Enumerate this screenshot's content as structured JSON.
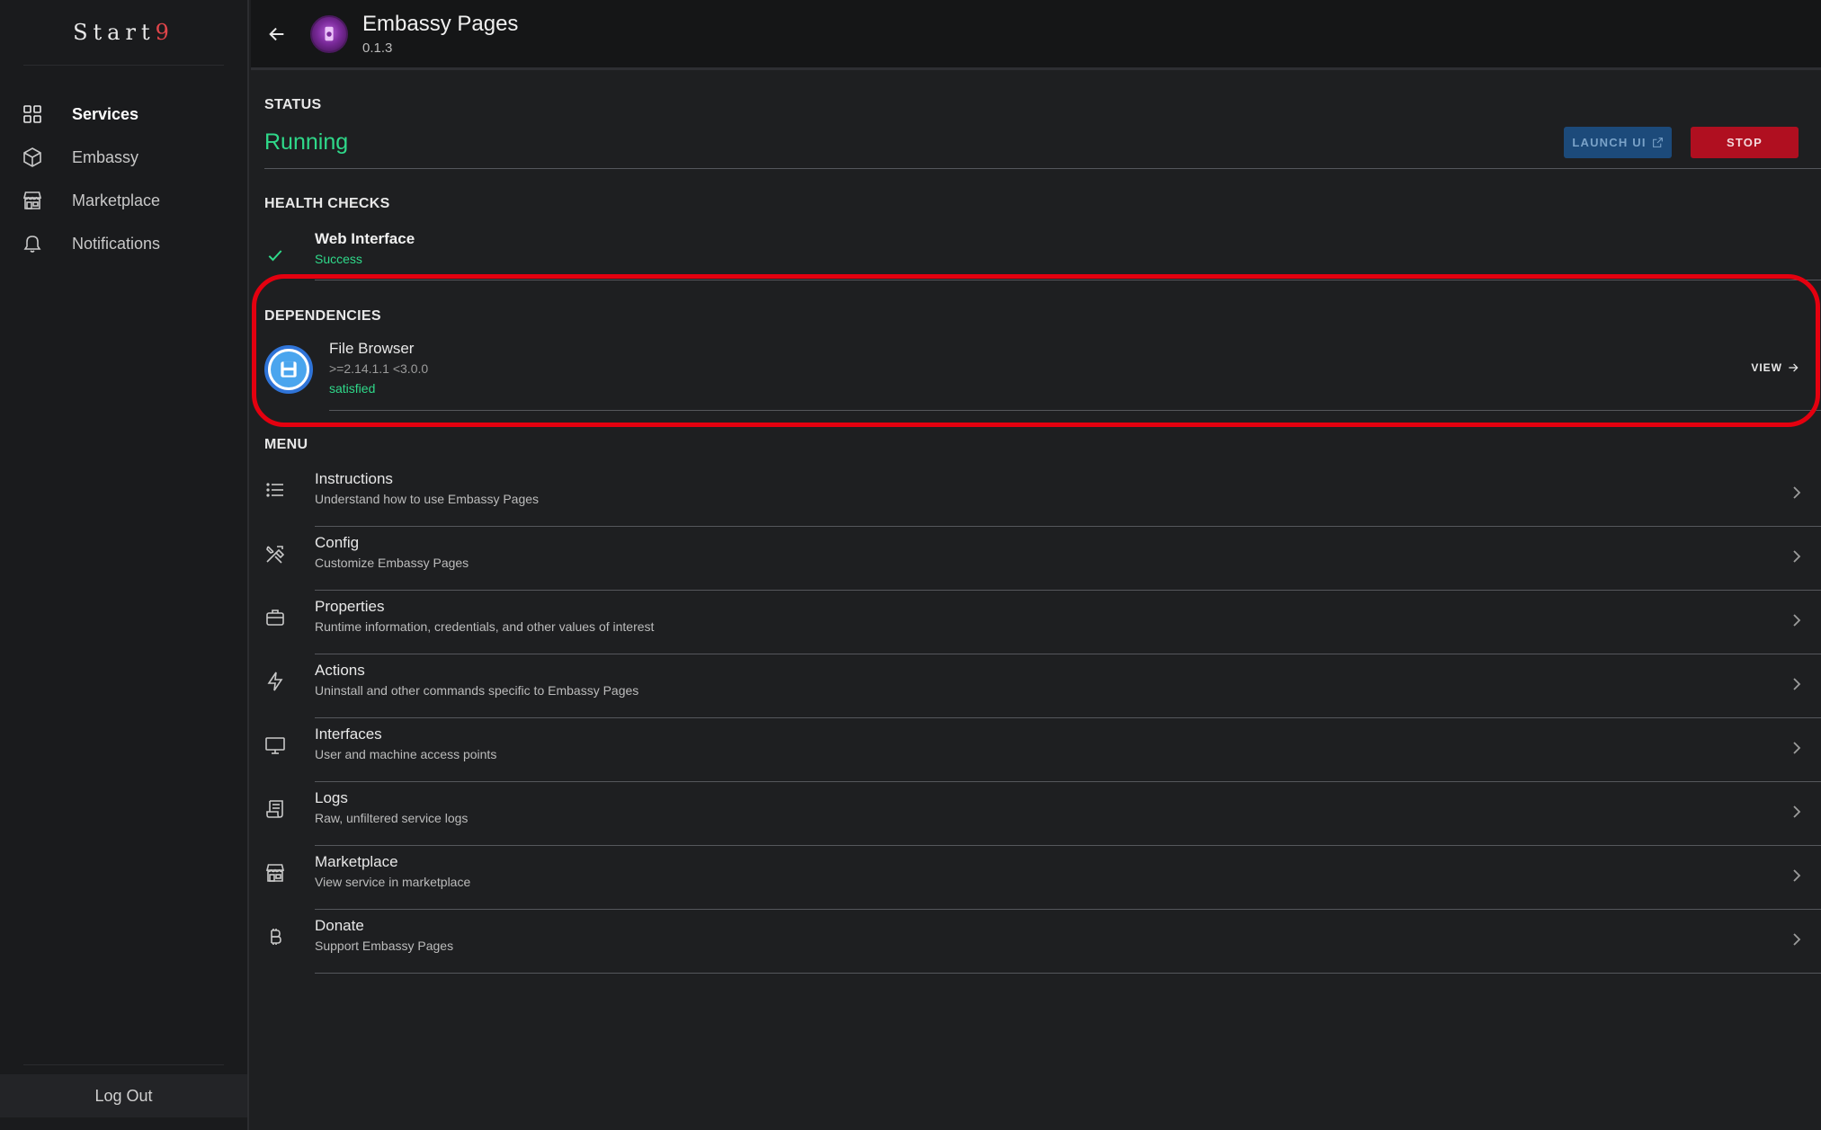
{
  "sidebar": {
    "logo_text": "Start",
    "logo_accent": "9",
    "items": [
      {
        "label": "Services",
        "icon": "grid-icon",
        "active": true
      },
      {
        "label": "Embassy",
        "icon": "cube-icon"
      },
      {
        "label": "Marketplace",
        "icon": "storefront-icon"
      },
      {
        "label": "Notifications",
        "icon": "bell-icon"
      }
    ],
    "logout_label": "Log Out"
  },
  "header": {
    "title": "Embassy Pages",
    "version": "0.1.3"
  },
  "status": {
    "title": "STATUS",
    "value": "Running",
    "launch_label": "LAUNCH UI",
    "stop_label": "STOP"
  },
  "health": {
    "title": "HEALTH CHECKS",
    "checks": [
      {
        "name": "Web Interface",
        "result": "Success"
      }
    ]
  },
  "dependencies": {
    "title": "DEPENDENCIES",
    "items": [
      {
        "name": "File Browser",
        "version": ">=2.14.1.1 <3.0.0",
        "status": "satisfied",
        "view_label": "VIEW"
      }
    ]
  },
  "menu": {
    "title": "MENU",
    "items": [
      {
        "name": "Instructions",
        "desc": "Understand how to use Embassy Pages",
        "icon": "list-icon"
      },
      {
        "name": "Config",
        "desc": "Customize Embassy Pages",
        "icon": "tools-icon"
      },
      {
        "name": "Properties",
        "desc": "Runtime information, credentials, and other values of interest",
        "icon": "briefcase-icon"
      },
      {
        "name": "Actions",
        "desc": "Uninstall and other commands specific to Embassy Pages",
        "icon": "lightning-icon"
      },
      {
        "name": "Interfaces",
        "desc": "User and machine access points",
        "icon": "monitor-icon"
      },
      {
        "name": "Logs",
        "desc": "Raw, unfiltered service logs",
        "icon": "receipt-icon"
      },
      {
        "name": "Marketplace",
        "desc": "View service in marketplace",
        "icon": "storefront-icon"
      },
      {
        "name": "Donate",
        "desc": "Support Embassy Pages",
        "icon": "bitcoin-icon"
      }
    ]
  },
  "colors": {
    "accent_green": "#2fd98a",
    "stop_red": "#b00f20",
    "launch_blue": "#1c4a7a",
    "highlight_red": "#e4000f"
  }
}
